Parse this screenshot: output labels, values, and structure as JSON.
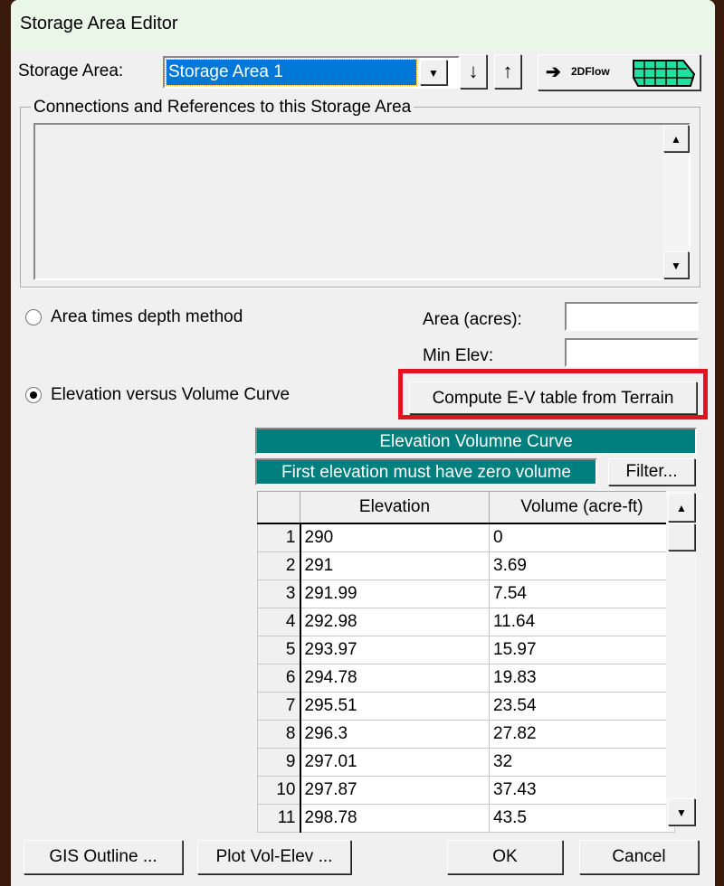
{
  "title": "Storage Area Editor",
  "storage_area_label": "Storage Area:",
  "storage_area_value": "Storage Area 1",
  "twod_flow_label": "2DFlow",
  "connections_group": "Connections and References to this Storage Area",
  "area_method_label": "Area times depth method",
  "area_label": "Area (acres):",
  "min_elev_label": "Min Elev:",
  "ev_curve_label": "Elevation versus Volume Curve",
  "compute_button": "Compute E-V table from Terrain",
  "table_title": "Elevation Volumne Curve",
  "table_note": "First elevation must have zero volume",
  "filter_button": "Filter...",
  "columns": [
    "Elevation",
    "Volume (acre-ft)"
  ],
  "rows": [
    [
      "1",
      "290",
      "0"
    ],
    [
      "2",
      "291",
      "3.69"
    ],
    [
      "3",
      "291.99",
      "7.54"
    ],
    [
      "4",
      "292.98",
      "11.64"
    ],
    [
      "5",
      "293.97",
      "15.97"
    ],
    [
      "6",
      "294.78",
      "19.83"
    ],
    [
      "7",
      "295.51",
      "23.54"
    ],
    [
      "8",
      "296.3",
      "27.82"
    ],
    [
      "9",
      "297.01",
      "32"
    ],
    [
      "10",
      "297.87",
      "37.43"
    ],
    [
      "11",
      "298.78",
      "43.5"
    ]
  ],
  "buttons": {
    "gis": "GIS Outline ...",
    "plot": "Plot Vol-Elev ...",
    "ok": "OK",
    "cancel": "Cancel"
  },
  "highlight_color": "#e0141e"
}
